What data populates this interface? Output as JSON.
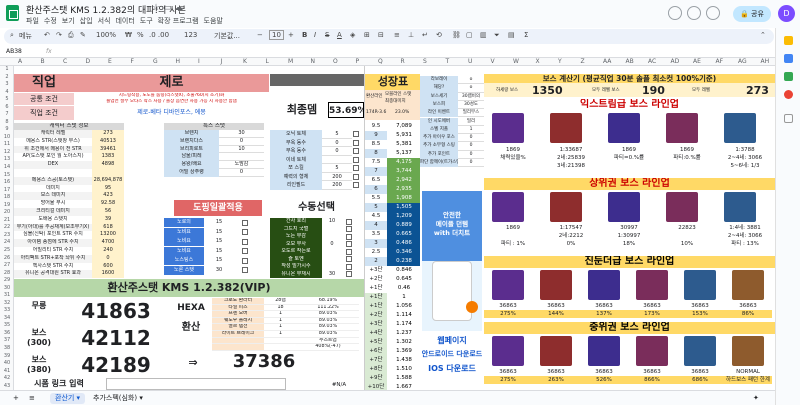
{
  "app": {
    "title": "환산주스탯 KMS 1.2.382의 대파!의 사본",
    "menu": [
      "파일",
      "수정",
      "보기",
      "삽입",
      "서식",
      "데이터",
      "도구",
      "확장 프로그램",
      "도움말"
    ],
    "share_label": "공유",
    "avatar_letter": "D"
  },
  "toolbar": {
    "search_label": "메뉴",
    "zoom": "100%",
    "currency": "₩",
    "percent": "%",
    "decimals": ".0  .00",
    "format": "123",
    "font": "기본값...",
    "font_size": "10"
  },
  "formula_bar": {
    "cell_ref": "AB38",
    "fx": "fx"
  },
  "columns": [
    "A",
    "B",
    "C",
    "D",
    "E",
    "F",
    "G",
    "H",
    "I",
    "J",
    "K",
    "L",
    "M",
    "N",
    "O",
    "P",
    "Q",
    "R",
    "S",
    "T",
    "U",
    "V",
    "W",
    "X",
    "Y",
    "Z",
    "AA",
    "AB",
    "AC",
    "AD",
    "AE",
    "AF",
    "AG",
    "AH"
  ],
  "rows": [
    "1",
    "2",
    "3",
    "4",
    "5",
    "6",
    "7",
    "8",
    "9",
    "10",
    "11",
    "12",
    "13",
    "14",
    "15",
    "16",
    "17",
    "18",
    "19",
    "20",
    "21",
    "22",
    "23",
    "24",
    "25",
    "26",
    "27",
    "28",
    "29",
    "30",
    "31",
    "32",
    "33",
    "34",
    "35",
    "36",
    "37",
    "38",
    "39",
    "40",
    "41",
    "42",
    "43"
  ],
  "left": {
    "job_label": "직업",
    "job_value": "제로",
    "common_label": "공통 조건",
    "common_text": "시드링착용, 노도들 룹링(리스탯X), 소울?60(지 조기)화",
    "common_text2": "즐업먼 절부 오타스 착스 사용 / 솔상 음연한 사용 가능 시 사용안 함잼",
    "job_cond_label": "직업 조건",
    "job_cond_text": "제로-베타 디바인포스, 에몽",
    "stat_header": "캐릭터 스탯 정보",
    "hexa_stat_header": "특스 스탯",
    "stats": [
      [
        "캐릭터 레벨",
        "273"
      ],
      [
        "메용스 STR(스탯창 무스)",
        "40513"
      ],
      [
        "위 조건에서 메용이 전 STR",
        "39461"
      ],
      [
        "AP(도스탯 포인 월 노아스지)",
        "1383"
      ],
      [
        "DEX",
        "4898"
      ],
      [
        "",
        ""
      ],
      [
        "메용스 스공(토스탯)",
        "28,694,878"
      ],
      [
        "데미지",
        "95"
      ],
      [
        "보스 데미지",
        "423"
      ],
      [
        "방어율 무시",
        "92.58"
      ],
      [
        "크리티컬 데미지",
        "56"
      ],
      [
        "도배용 스탯치",
        "39"
      ],
      [
        "무기(아대)를 추공채계(보조무기X)",
        "618"
      ],
      [
        "심볼(신탁) 포인트 STR 수치",
        "13200"
      ],
      [
        "아이템 종점에 STR 수치",
        "4700"
      ],
      [
        "어빌리티 STR 수치",
        "240"
      ],
      [
        "아티팩트 STR+포착 놔뒤 수치",
        "0"
      ],
      [
        "헥사스탯 STR 수치",
        "600"
      ],
      [
        "유니온 공격대원 STR 효과",
        "1600"
      ]
    ],
    "mid_stats": [
      [
        "브렌치",
        "30"
      ],
      [
        "브렌치다스",
        "0"
      ],
      [
        "브리피로트",
        "10"
      ],
      [
        "남울/피레",
        ""
      ],
      [
        "용왕/배요",
        "노밤감"
      ],
      [
        "어빌 상주령",
        "0"
      ]
    ],
    "hyper": [
      "노로의",
      "노비요",
      "노비요",
      "노비요",
      "노스팅스",
      "노론 스탯"
    ],
    "hyper_values": [
      "15",
      "15",
      "15",
      "15",
      "15",
      "30"
    ],
    "right_labels": [
      [
        "오닉 토체",
        "5"
      ],
      [
        "부옥 동수",
        "0"
      ],
      [
        "부옥 동수",
        "0"
      ],
      [
        "이네 토체",
        ""
      ],
      [
        "쪼 스킬",
        "5"
      ],
      [
        "예력의 형체",
        "200"
      ],
      [
        "리인필드",
        "200"
      ]
    ],
    "free_label": "도핑일괄적용",
    "manual_label": "수동선택",
    "right_list": [
      [
        "간사 호리",
        "10"
      ],
      [
        "그드지 국벌",
        ""
      ],
      [
        "노든 무감",
        ""
      ],
      [
        "오모 무사",
        "0"
      ],
      [
        "오도르 작는로",
        ""
      ],
      [
        "즐 토엔",
        ""
      ],
      [
        "작성 밀가시수",
        ""
      ],
      [
        "유니온 부재시",
        "30"
      ]
    ],
    "hwansan_title": "환산주스탯 KMS 1.2.382(VIP)",
    "results": [
      {
        "label": "무릉",
        "value": "41863"
      },
      {
        "label": "보스\n(300)",
        "value": "42112"
      },
      {
        "label": "보스\n(380)",
        "value": "42189"
      }
    ],
    "hexa_label": "HEXA",
    "hexa_conv_label": "환산",
    "final_value": "37386",
    "conv_rows": [
      [
        "크로노 환라터",
        "28렙",
        "68.19%"
      ],
      [
        "타일 피스",
        "18",
        "111.22%"
      ],
      [
        "프렌 오버",
        "1",
        "89.03%"
      ],
      [
        "쉐도우 플레시",
        "1",
        "89.03%"
      ],
      [
        "얼르 템전",
        "1",
        "89.03%"
      ],
      [
        "라이트 브레이크",
        "1",
        "89.03%"
      ],
      [
        "",
        "",
        "주스트업"
      ],
      [
        "",
        "",
        "408%(-47)"
      ]
    ],
    "link_label": "시폼 링크 입력",
    "ab_label": "#N/A"
  },
  "growth": {
    "header": "성장표",
    "top_labels": [
      "환산라인",
      "모블라인 스탯",
      "최종대미지"
    ],
    "top_values": [
      "174R-3.6",
      "",
      ""
    ],
    "top_percent": "23.0%",
    "final_label": "최종뎀",
    "final_pct": "53.69%",
    "rows": [
      [
        "9.5",
        "7,089"
      ],
      [
        "9",
        "5,931"
      ],
      [
        "8.5",
        "5,381"
      ],
      [
        "8",
        "5,137"
      ],
      [
        "7.5",
        "4,175"
      ],
      [
        "7",
        "3,744"
      ],
      [
        "6.5",
        "2,942"
      ],
      [
        "6",
        "2,935"
      ],
      [
        "5.5",
        "1,908"
      ],
      [
        "5",
        "1,505"
      ],
      [
        "4.5",
        "1,209"
      ],
      [
        "4",
        "0.889"
      ],
      [
        "3.5",
        "0.665"
      ],
      [
        "3",
        "0.486"
      ],
      [
        "2.5",
        "0.346"
      ],
      [
        "2",
        "0.238"
      ],
      [
        "+3단",
        "0.846"
      ],
      [
        "+2단",
        "0.645"
      ],
      [
        "+1단",
        "0.46"
      ],
      [
        "+1단",
        "1"
      ],
      [
        "+1단",
        "1.056"
      ],
      [
        "+2단",
        "1.114"
      ],
      [
        "+3단",
        "1.174"
      ],
      [
        "+4단",
        "1.237"
      ],
      [
        "+5단",
        "1.302"
      ],
      [
        "+6단",
        "1.369"
      ],
      [
        "+7단",
        "1.438"
      ],
      [
        "+8단",
        "1.510"
      ],
      [
        "+9단",
        "1.588"
      ],
      [
        "+10단",
        "1.667"
      ]
    ],
    "opt_rows": [
      [
        "라보레이",
        "o"
      ],
      [
        "해당?",
        "o"
      ],
      [
        "보스세기",
        "30렙비의"
      ],
      [
        "보스피",
        "30성도"
      ],
      [
        "라인 이벤트",
        "밀리무스"
      ],
      [
        "인 시도에버",
        "밀리"
      ],
      [
        "스벨 지폴",
        "1"
      ],
      [
        "추가 아이우 포스",
        "0"
      ],
      [
        "추가 소무형 스팅",
        "0"
      ],
      [
        "추가 포인트",
        "0"
      ],
      [
        "파단 함께이(트가스텐이트)",
        "0"
      ]
    ]
  },
  "ad": {
    "title": "안전한\n메이플 던템\nwith 더치트",
    "links": [
      "웹페이지",
      "안드로이드 다운로드",
      "IOS 다운로드"
    ]
  },
  "boss": {
    "title": "보스 계산기 (평균직업 30분 솔플 최소컷 100%기준)",
    "labels": [
      "하세랑 보스",
      "1350",
      "모두 레벨 보스",
      "190",
      "모두 레벨",
      "273"
    ],
    "sections": [
      "익스트림급 보스 라인업",
      "상위권 보스 라인업",
      "진둔더급 보스 라인업",
      "중위권 보스 라인업"
    ],
    "ext_values": [
      [
        "1869",
        "1:33687",
        "1869",
        "1869",
        "1:3788"
      ],
      [
        "채력있을%",
        "2네:25839",
        "파티=0.%률",
        "파티:0.%률",
        "2~4네: 3066"
      ],
      [
        "",
        "3네:21398",
        "",
        "",
        "5~6네: 1/3"
      ]
    ],
    "high_values": [
      [
        "1869",
        "1:17547",
        "30997",
        "22823",
        "1:4네: 3881"
      ],
      [
        "",
        "2네:2212",
        "1:30997",
        "",
        "2~4네: 3066"
      ],
      [
        "파티 : 1%",
        "0%",
        "18%",
        "10%",
        "파티 : 13%"
      ]
    ],
    "jin_values": [
      [
        "36863",
        "36863",
        "36863",
        "36863",
        "36863",
        "36863"
      ],
      [
        "275%",
        "144%",
        "137%",
        "173%",
        "153%",
        "86%"
      ]
    ],
    "mid_values": [
      [
        "36863",
        "36863",
        "36863",
        "36863",
        "36863",
        "NORMAL"
      ],
      [
        "275%",
        "263%",
        "526%",
        "866%",
        "686%",
        "하드보스 패턴 한계"
      ]
    ],
    "section_colors": [
      "#ffd966",
      "#ffd966",
      "#ffd966",
      "#ffd966"
    ]
  },
  "sheets": {
    "tabs": [
      "환산기",
      "추가스펙(심화)"
    ],
    "add_label": "+",
    "menu_label": "≡"
  }
}
